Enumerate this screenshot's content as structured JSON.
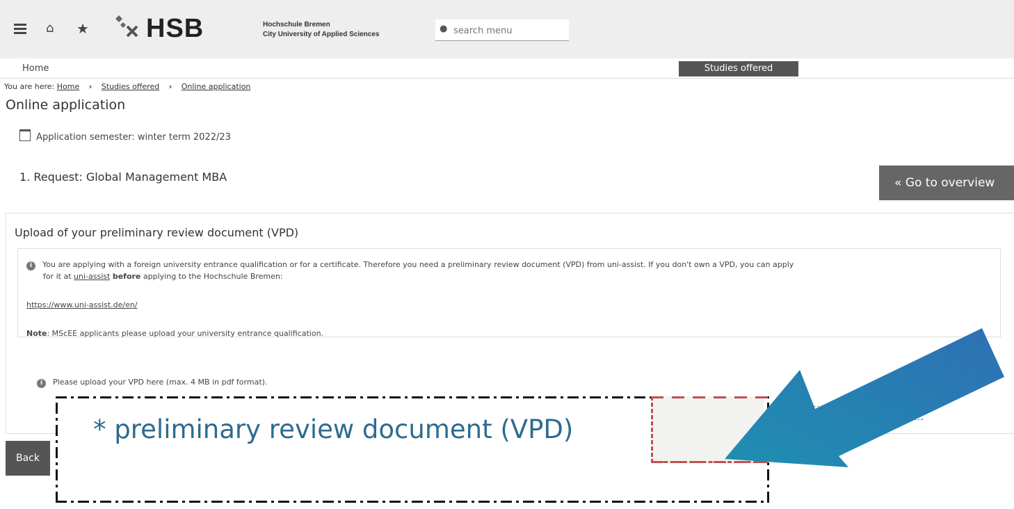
{
  "header": {
    "logo_text": "HSB",
    "university_line1": "Hochschule Bremen",
    "university_line2": "City University of Applied Sciences",
    "search_placeholder": "search menu"
  },
  "nav": {
    "home_label": "Home",
    "active_section": "Studies offered"
  },
  "breadcrumb": {
    "prefix": "You are here:",
    "items": [
      "Home",
      "Studies offered",
      "Online application"
    ]
  },
  "page": {
    "title": "Online application",
    "semester": "Application semester: winter term 2022/23",
    "request": "1. Request: Global Management MBA",
    "overview_button": "Go to overview"
  },
  "panel": {
    "title": "Upload of your preliminary review document (VPD)",
    "info_line1": "You are applying with a foreign university entrance qualification or for a certificate. Therefore you need a preliminary review document (VPD) from uni-assist. If you don't own a VPD, you can apply",
    "info_line2_pre": "for it at",
    "info_line2_link": "uni-assist",
    "info_line2_bold": "before",
    "info_line2_post": "applying to the Hochschule Bremen:",
    "info_url": "https://www.uni-assist.de/en/",
    "note_label": "Note",
    "note_text": ": MScEE applicants please upload your university entrance qualification.",
    "upload_hint": "Please upload your VPD here (max. 4 MB in pdf format)."
  },
  "footer": {
    "back_button": "Back"
  },
  "zoom": {
    "field_label": "* preliminary review document (VPD)"
  },
  "colors": {
    "accent_blue": "#2e6b8f",
    "arrow_blue": "#2a80b9",
    "dashed_red": "#c0504d"
  }
}
